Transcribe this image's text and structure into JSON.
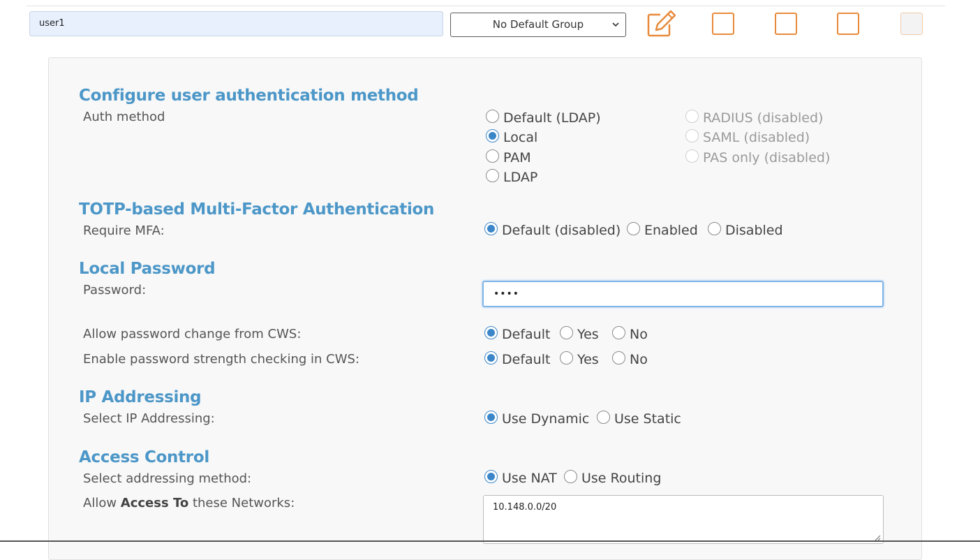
{
  "topbar": {
    "username": "user1",
    "group_select": "No Default Group",
    "icons": [
      "edit-icon",
      "square-icon",
      "square-icon",
      "square-icon",
      "square-icon"
    ]
  },
  "auth": {
    "title": "Configure user authentication method",
    "label": "Auth method",
    "options": {
      "default_ldap": "Default (LDAP)",
      "local": "Local",
      "pam": "PAM",
      "ldap": "LDAP",
      "radius": "RADIUS (disabled)",
      "saml": "SAML (disabled)",
      "pas_only": "PAS only (disabled)"
    },
    "selected": "Local"
  },
  "mfa": {
    "title": "TOTP-based Multi-Factor Authentication",
    "label": "Require MFA:",
    "options": {
      "default": "Default (disabled)",
      "enabled": "Enabled",
      "disabled": "Disabled"
    },
    "selected": "Default (disabled)"
  },
  "password": {
    "title": "Local Password",
    "label": "Password:",
    "value": "••••",
    "change_label": "Allow password change from CWS:",
    "strength_label": "Enable password strength checking in CWS:",
    "options": {
      "default": "Default",
      "yes": "Yes",
      "no": "No"
    },
    "change_selected": "Default",
    "strength_selected": "Default"
  },
  "ip": {
    "title": "IP Addressing",
    "label": "Select IP Addressing:",
    "options": {
      "dynamic": "Use Dynamic",
      "static": "Use Static"
    },
    "selected": "Use Dynamic"
  },
  "access": {
    "title": "Access Control",
    "method_label": "Select addressing method:",
    "options": {
      "nat": "Use NAT",
      "routing": "Use Routing"
    },
    "selected": "Use NAT",
    "networks_label_pre": "Allow ",
    "networks_label_bold": "Access To",
    "networks_label_post": " these Networks:",
    "networks_value": "10.148.0.0/20"
  },
  "colors": {
    "accent_title": "#4c97c8",
    "radio_checked": "#3b86c9",
    "icon_orange": "#e88a3a",
    "input_autofill": "#e8f0fe"
  }
}
